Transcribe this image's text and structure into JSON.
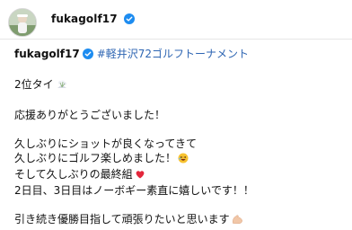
{
  "post": {
    "header": {
      "username": "fukagolf17",
      "verified": true,
      "avatar_desc": "avatar"
    },
    "caption": {
      "username": "fukagolf17",
      "hashtag": "#軽井沢72ゴルフトーナメント",
      "lines": [
        "2位タイ",
        "",
        "応援ありがとうございました！",
        "",
        "久しぶりにショットが良くなってきて",
        "久しぶりにゴルフ楽しめました！",
        "そして久しぶりの最終組",
        "2日目、3日目はノーボギー素直に嬉しいです！！",
        "",
        "引き続き優勝目指して頑張りたいと思います"
      ]
    },
    "colors": {
      "verified_blue": "#1d8cf0",
      "hashtag": "#2f66b3"
    },
    "icons": [
      "verified-badge-icon",
      "bouquet-icon",
      "laughing-face-icon",
      "red-heart-icon",
      "flexed-biceps-icon"
    ]
  }
}
